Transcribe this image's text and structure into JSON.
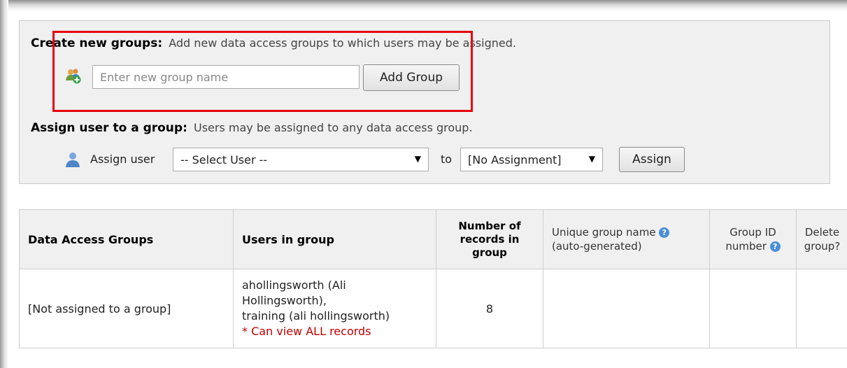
{
  "create": {
    "heading": "Create new groups:",
    "description": "Add new data access groups to which users may be assigned.",
    "input_placeholder": "Enter new group name",
    "add_button": "Add Group",
    "icon": "user-group-add-icon"
  },
  "assign": {
    "heading": "Assign user to a group:",
    "description": "Users may be assigned to any data access group.",
    "label": "Assign user",
    "user_select": "-- Select User --",
    "to_label": "to",
    "group_select": "[No Assignment]",
    "assign_button": "Assign",
    "icon": "user-icon"
  },
  "table": {
    "headers": {
      "groups": "Data Access Groups",
      "users": "Users in group",
      "records_1": "Number of",
      "records_2": "records in",
      "records_3": "group",
      "unique_1": "Unique group name",
      "unique_2": "(auto-generated)",
      "gid_1": "Group ID",
      "gid_2": "number",
      "delete_1": "Delete",
      "delete_2": "group?"
    },
    "row": {
      "group": "[Not assigned to a group]",
      "users_1": "ahollingsworth (Ali",
      "users_2": "Hollingsworth),",
      "users_3": "training (ali hollingsworth)",
      "note": "* Can view ALL records",
      "records": "8"
    }
  },
  "colors": {
    "highlight": "#e8000b",
    "link": "#8b1a1a",
    "warning": "#c00000",
    "help": "#4a8fd6"
  }
}
